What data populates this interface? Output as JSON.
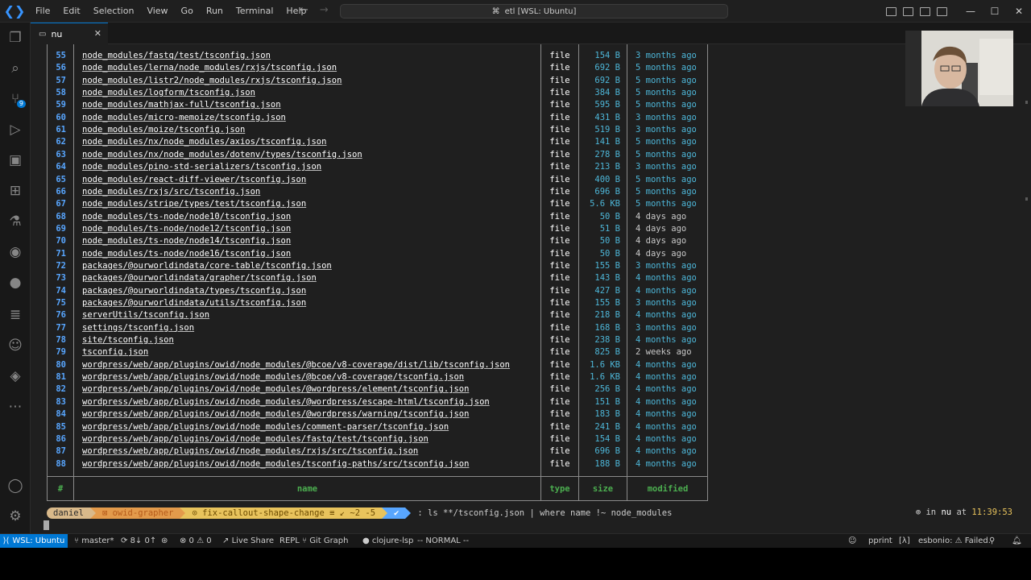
{
  "menu": [
    "File",
    "Edit",
    "Selection",
    "View",
    "Go",
    "Run",
    "Terminal",
    "Help"
  ],
  "command_center": "etl [WSL: Ubuntu]",
  "activity_badge": "9",
  "tab": {
    "label": "nu",
    "close": "✕"
  },
  "table": {
    "headers": {
      "idx": "#",
      "name": "name",
      "type": "type",
      "size": "size",
      "modified": "modified"
    },
    "rows": [
      {
        "idx": "55",
        "name": "node_modules/fastq/test/tsconfig.json",
        "type": "file",
        "size": "154 B",
        "modified": "3 months ago"
      },
      {
        "idx": "56",
        "name": "node_modules/lerna/node_modules/rxjs/tsconfig.json",
        "type": "file",
        "size": "692 B",
        "modified": "5 months ago"
      },
      {
        "idx": "57",
        "name": "node_modules/listr2/node_modules/rxjs/tsconfig.json",
        "type": "file",
        "size": "692 B",
        "modified": "5 months ago"
      },
      {
        "idx": "58",
        "name": "node_modules/logform/tsconfig.json",
        "type": "file",
        "size": "384 B",
        "modified": "5 months ago"
      },
      {
        "idx": "59",
        "name": "node_modules/mathjax-full/tsconfig.json",
        "type": "file",
        "size": "595 B",
        "modified": "5 months ago"
      },
      {
        "idx": "60",
        "name": "node_modules/micro-memoize/tsconfig.json",
        "type": "file",
        "size": "431 B",
        "modified": "3 months ago"
      },
      {
        "idx": "61",
        "name": "node_modules/moize/tsconfig.json",
        "type": "file",
        "size": "519 B",
        "modified": "3 months ago"
      },
      {
        "idx": "62",
        "name": "node_modules/nx/node_modules/axios/tsconfig.json",
        "type": "file",
        "size": "141 B",
        "modified": "5 months ago"
      },
      {
        "idx": "63",
        "name": "node_modules/nx/node_modules/dotenv/types/tsconfig.json",
        "type": "file",
        "size": "278 B",
        "modified": "5 months ago"
      },
      {
        "idx": "64",
        "name": "node_modules/pino-std-serializers/tsconfig.json",
        "type": "file",
        "size": "213 B",
        "modified": "3 months ago"
      },
      {
        "idx": "65",
        "name": "node_modules/react-diff-viewer/tsconfig.json",
        "type": "file",
        "size": "400 B",
        "modified": "5 months ago"
      },
      {
        "idx": "66",
        "name": "node_modules/rxjs/src/tsconfig.json",
        "type": "file",
        "size": "696 B",
        "modified": "5 months ago"
      },
      {
        "idx": "67",
        "name": "node_modules/stripe/types/test/tsconfig.json",
        "type": "file",
        "size": "5.6 KB",
        "modified": "5 months ago"
      },
      {
        "idx": "68",
        "name": "node_modules/ts-node/node10/tsconfig.json",
        "type": "file",
        "size": "50 B",
        "modified": "4 days ago"
      },
      {
        "idx": "69",
        "name": "node_modules/ts-node/node12/tsconfig.json",
        "type": "file",
        "size": "51 B",
        "modified": "4 days ago"
      },
      {
        "idx": "70",
        "name": "node_modules/ts-node/node14/tsconfig.json",
        "type": "file",
        "size": "50 B",
        "modified": "4 days ago"
      },
      {
        "idx": "71",
        "name": "node_modules/ts-node/node16/tsconfig.json",
        "type": "file",
        "size": "50 B",
        "modified": "4 days ago"
      },
      {
        "idx": "72",
        "name": "packages/@ourworldindata/core-table/tsconfig.json",
        "type": "file",
        "size": "155 B",
        "modified": "3 months ago"
      },
      {
        "idx": "73",
        "name": "packages/@ourworldindata/grapher/tsconfig.json",
        "type": "file",
        "size": "143 B",
        "modified": "4 months ago"
      },
      {
        "idx": "74",
        "name": "packages/@ourworldindata/types/tsconfig.json",
        "type": "file",
        "size": "427 B",
        "modified": "4 months ago"
      },
      {
        "idx": "75",
        "name": "packages/@ourworldindata/utils/tsconfig.json",
        "type": "file",
        "size": "155 B",
        "modified": "3 months ago"
      },
      {
        "idx": "76",
        "name": "serverUtils/tsconfig.json",
        "type": "file",
        "size": "218 B",
        "modified": "4 months ago"
      },
      {
        "idx": "77",
        "name": "settings/tsconfig.json",
        "type": "file",
        "size": "168 B",
        "modified": "3 months ago"
      },
      {
        "idx": "78",
        "name": "site/tsconfig.json",
        "type": "file",
        "size": "238 B",
        "modified": "4 months ago"
      },
      {
        "idx": "79",
        "name": "tsconfig.json",
        "type": "file",
        "size": "825 B",
        "modified": "2 weeks ago"
      },
      {
        "idx": "80",
        "name": "wordpress/web/app/plugins/owid/node_modules/@bcoe/v8-coverage/dist/lib/tsconfig.json",
        "type": "file",
        "size": "1.6 KB",
        "modified": "4 months ago"
      },
      {
        "idx": "81",
        "name": "wordpress/web/app/plugins/owid/node_modules/@bcoe/v8-coverage/tsconfig.json",
        "type": "file",
        "size": "1.6 KB",
        "modified": "4 months ago"
      },
      {
        "idx": "82",
        "name": "wordpress/web/app/plugins/owid/node_modules/@wordpress/element/tsconfig.json",
        "type": "file",
        "size": "256 B",
        "modified": "4 months ago"
      },
      {
        "idx": "83",
        "name": "wordpress/web/app/plugins/owid/node_modules/@wordpress/escape-html/tsconfig.json",
        "type": "file",
        "size": "151 B",
        "modified": "4 months ago"
      },
      {
        "idx": "84",
        "name": "wordpress/web/app/plugins/owid/node_modules/@wordpress/warning/tsconfig.json",
        "type": "file",
        "size": "183 B",
        "modified": "4 months ago"
      },
      {
        "idx": "85",
        "name": "wordpress/web/app/plugins/owid/node_modules/comment-parser/tsconfig.json",
        "type": "file",
        "size": "241 B",
        "modified": "4 months ago"
      },
      {
        "idx": "86",
        "name": "wordpress/web/app/plugins/owid/node_modules/fastq/test/tsconfig.json",
        "type": "file",
        "size": "154 B",
        "modified": "4 months ago"
      },
      {
        "idx": "87",
        "name": "wordpress/web/app/plugins/owid/node_modules/rxjs/src/tsconfig.json",
        "type": "file",
        "size": "696 B",
        "modified": "4 months ago"
      },
      {
        "idx": "88",
        "name": "wordpress/web/app/plugins/owid/node_modules/tsconfig-paths/src/tsconfig.json",
        "type": "file",
        "size": "188 B",
        "modified": "4 months ago"
      }
    ]
  },
  "prompt": {
    "user": "daniel",
    "dir_icon": "⊠",
    "dir": "owid-grapher",
    "branch_icon": "⊙",
    "branch": "fix-callout-shape-change ≡ ↙ ~2 -5",
    "ok": "✔",
    "command": ": ls **/tsconfig.json | where name !~ node_modules",
    "right_prefix": "⊕ in",
    "right_dir": "nu",
    "right_at": "at",
    "time": "11:39:53"
  },
  "statusbar": {
    "remote": "WSL: Ubuntu",
    "branch": "master*",
    "sync": "8↓ 0↑",
    "problems": "⊗ 0 ⚠ 0",
    "liveshare": "Live Share",
    "repl": "REPL",
    "gitgraph": "Git Graph",
    "clojure": "● clojure-lsp",
    "mode": "-- NORMAL --",
    "pprint": "pprint",
    "lambda": "[λ]",
    "esbonio": "esbonio: ⚠ Failed."
  }
}
